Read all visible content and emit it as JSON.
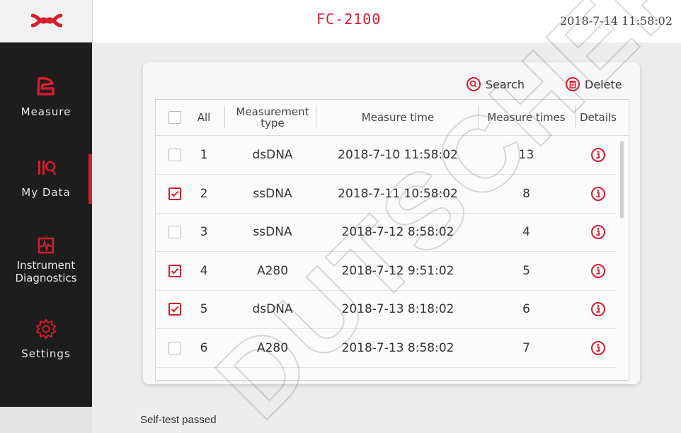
{
  "header": {
    "logo_icon": "brand-logo-icon",
    "title": "FC-2100",
    "datetime": "2018-7-14  11:58:02"
  },
  "sidebar": {
    "items": [
      {
        "label": "Measure",
        "icon": "measure-icon"
      },
      {
        "label": "My Data",
        "icon": "data-icon",
        "active": true
      },
      {
        "label": "Instrument\nDiagnostics",
        "label_line1": "Instrument",
        "label_line2": "Diagnostics",
        "icon": "pulse-monitor-icon"
      },
      {
        "label": "Settings",
        "icon": "gear-icon"
      }
    ]
  },
  "toolbar": {
    "search_label": "Search",
    "delete_label": "Delete"
  },
  "table": {
    "headers": {
      "all": "All",
      "type_line1": "Measurement",
      "type_line2": "type",
      "time": "Measure time",
      "times": "Measure times",
      "details": "Details"
    },
    "rows": [
      {
        "no": "1",
        "type": "dsDNA",
        "time": "2018-7-10 11:58:02",
        "times": "13",
        "checked": false
      },
      {
        "no": "2",
        "type": "ssDNA",
        "time": "2018-7-11 10:58:02",
        "times": "8",
        "checked": true
      },
      {
        "no": "3",
        "type": "ssDNA",
        "time": "2018-7-12 8:58:02",
        "times": "4",
        "checked": false
      },
      {
        "no": "4",
        "type": "A280",
        "time": "2018-7-12 9:51:02",
        "times": "5",
        "checked": true
      },
      {
        "no": "5",
        "type": "dsDNA",
        "time": "2018-7-13 8:18:02",
        "times": "6",
        "checked": true
      },
      {
        "no": "6",
        "type": "A280",
        "time": "2018-7-13 8:58:02",
        "times": "7",
        "checked": false
      }
    ]
  },
  "status": {
    "text": "Self-test passed"
  },
  "watermark": {
    "text": "DUTSCHER"
  },
  "colors": {
    "accent": "#d71d2e",
    "sidebar_bg": "#1d1d1d"
  }
}
